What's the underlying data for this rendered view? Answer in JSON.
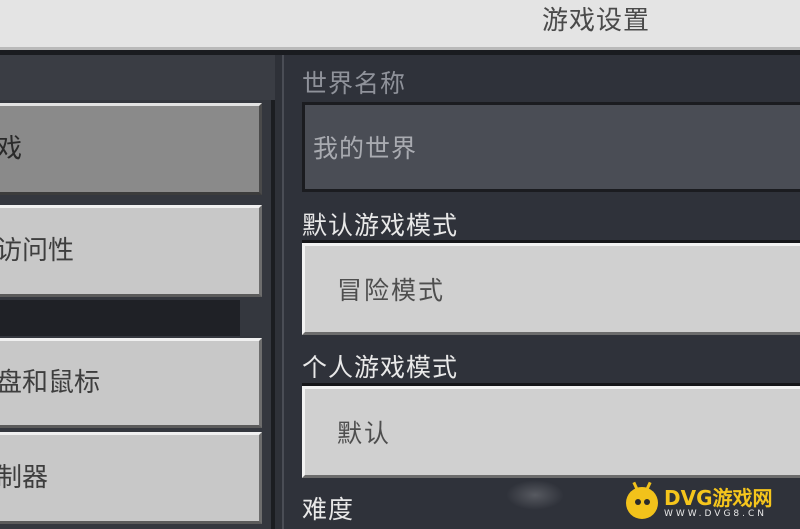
{
  "header": {
    "title": "游戏设置"
  },
  "sidebar": {
    "items": [
      {
        "label": "戏",
        "selected": true
      },
      {
        "label": "访问性",
        "selected": false
      },
      {
        "label": "盘和鼠标",
        "selected": false
      },
      {
        "label": "制器",
        "selected": false
      }
    ]
  },
  "settings": {
    "world_name_label": "世界名称",
    "world_name_value": "我的世界",
    "default_mode_label": "默认游戏模式",
    "default_mode_value": "冒险模式",
    "personal_mode_label": "个人游戏模式",
    "personal_mode_value": "默认",
    "difficulty_label": "难度"
  },
  "watermark": {
    "brand": "DVG游戏网",
    "url": "WWW.DVG8.CN"
  },
  "colors": {
    "background": "#2e3138",
    "button_face": "#c8c8c8",
    "button_selected": "#8a8a8a",
    "field_dark": "#4a4d55",
    "watermark_yellow": "#f5c51c"
  }
}
